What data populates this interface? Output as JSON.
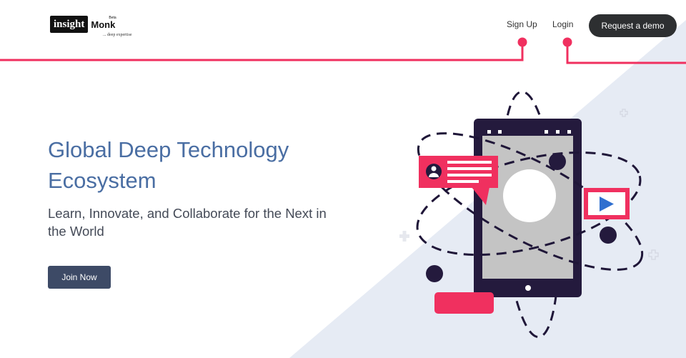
{
  "brand": {
    "logo_main": "insight",
    "logo_second": "Monk",
    "logo_badge": "Beta",
    "tagline": "... deep expertise"
  },
  "nav": {
    "signup": "Sign Up",
    "login": "Login",
    "demo": "Request a demo"
  },
  "hero": {
    "title_line1": "Global Deep Technology",
    "title_line2": "Ecosystem",
    "subtitle_line1": "Learn, Innovate, and Collaborate for the Next in",
    "subtitle_line2": "the World",
    "cta": "Join Now"
  },
  "colors": {
    "accent": "#f0305f",
    "title_blue": "#4a6ea3",
    "tablet_dark": "#241a3d",
    "screen_gray": "#c4c4c4",
    "bg_tint": "#e6ebf4",
    "play_blue": "#2f6fcf"
  },
  "icons": [
    "avatar-icon",
    "play-icon",
    "plus-icon"
  ]
}
